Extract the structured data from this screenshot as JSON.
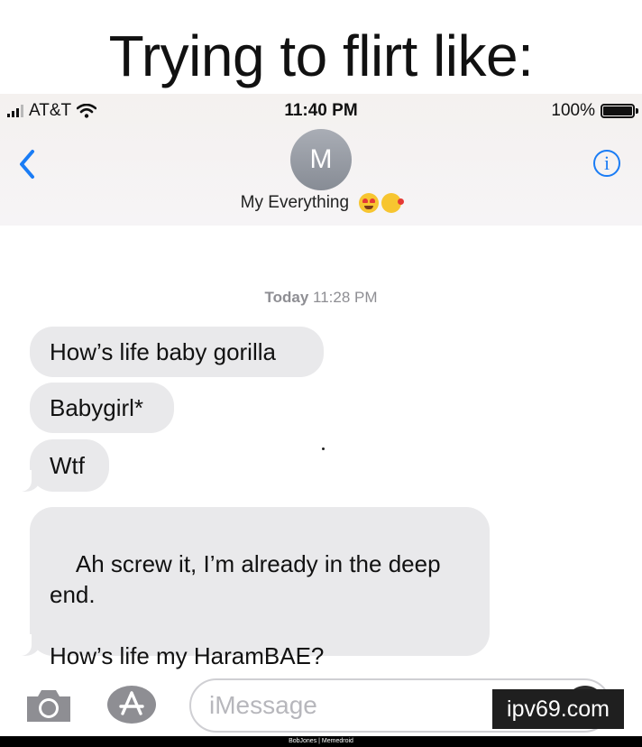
{
  "meme": {
    "caption": "Trying to flirt like:",
    "watermark": "ipv69.com",
    "credit": "BobJones | Memedroid"
  },
  "status_bar": {
    "carrier": "AT&T",
    "time": "11:40 PM",
    "battery": "100%",
    "battery_level": 1.0,
    "signal_bars": 4,
    "signal_bars_filled": 3
  },
  "header": {
    "avatar_initial": "M",
    "contact_name": "My Everything",
    "contact_emojis": [
      "heart-eyes-emoji",
      "kissing-heart-emoji"
    ],
    "back_icon": "chevron-left-icon",
    "info_icon": "info-icon",
    "info_glyph": "i",
    "accent_color": "#1a7cf5"
  },
  "conversation": {
    "timestamp_day": "Today",
    "timestamp_time": "11:28 PM",
    "messages": [
      {
        "text": "How’s life baby gorilla"
      },
      {
        "text": "Babygirl*"
      },
      {
        "text": "Wtf"
      },
      {
        "text": "Ah screw it, I’m already in the deep end.\n\nHow’s life my HaramBAE?"
      }
    ],
    "bubble_color": "#e9e9eb"
  },
  "input_bar": {
    "placeholder": "iMessage",
    "camera_icon": "camera-icon",
    "appstore_icon": "app-store-icon",
    "mic_icon": "microphone-icon"
  }
}
